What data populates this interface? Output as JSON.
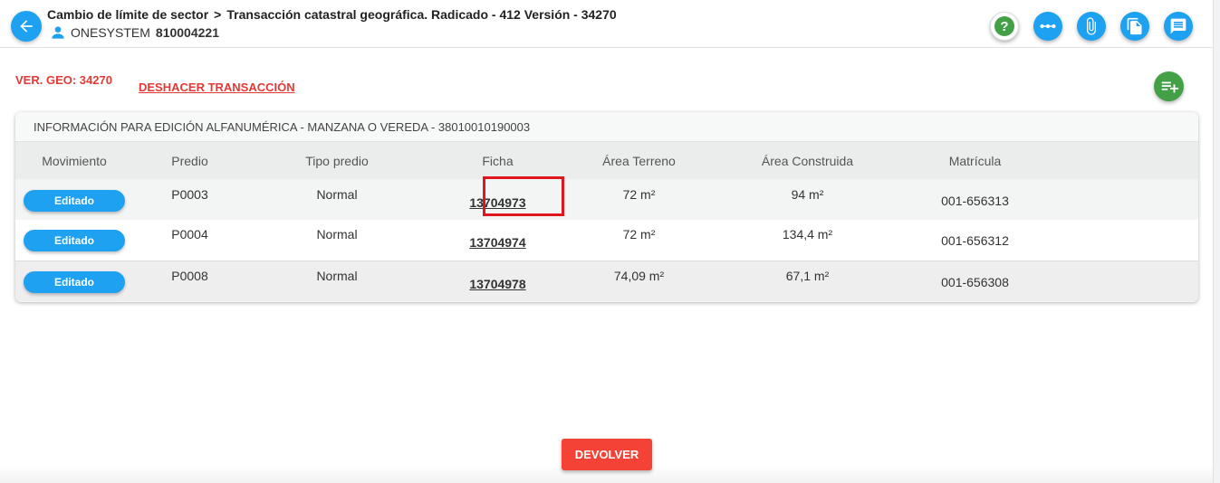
{
  "header": {
    "breadcrumb": [
      "Cambio de límite de sector",
      "Transacción catastral geográfica. Radicado - 412 Versión - 34270"
    ],
    "breadcrumb_sep": ">",
    "user_name": "ONESYSTEM",
    "user_id": "810004221",
    "tools": [
      "help-icon",
      "more-horizontal-icon",
      "attachment-icon",
      "documents-icon",
      "comment-icon"
    ]
  },
  "subbar": {
    "ver_geo": "VER. GEO: 34270",
    "undo_label": "DESHACER TRANSACCIÓN"
  },
  "panel": {
    "title": "INFORMACIÓN PARA EDICIÓN ALFANUMÉRICA - MANZANA O VEREDA - 38010010190003",
    "columns": [
      "Movimiento",
      "Predio",
      "Tipo predio",
      "Ficha",
      "Área Terreno",
      "Área Construida",
      "Matrícula"
    ],
    "rows": [
      {
        "movimiento": "Editado",
        "predio": "P0003",
        "tipo": "Normal",
        "ficha": "13704973",
        "area_terreno": "72 m²",
        "area_construida": "94 m²",
        "matricula": "001-656313"
      },
      {
        "movimiento": "Editado",
        "predio": "P0004",
        "tipo": "Normal",
        "ficha": "13704974",
        "area_terreno": "72 m²",
        "area_construida": "134,4 m²",
        "matricula": "001-656312"
      },
      {
        "movimiento": "Editado",
        "predio": "P0008",
        "tipo": "Normal",
        "ficha": "13704978",
        "area_terreno": "74,09 m²",
        "area_construida": "67,1 m²",
        "matricula": "001-656308"
      }
    ]
  },
  "footer": {
    "devolver_label": "DEVOLVER"
  },
  "colors": {
    "accent": "#1ea1f1",
    "danger": "#f44336",
    "success": "#43a047"
  }
}
